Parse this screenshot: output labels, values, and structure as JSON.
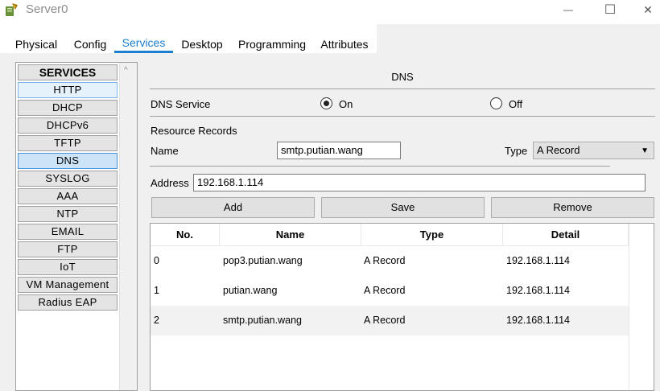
{
  "window": {
    "title": "Server0",
    "minimize_glyph": "—",
    "maximize_glyph": "☐",
    "close_glyph": "✕"
  },
  "tabs": [
    {
      "label": "Physical",
      "active": false
    },
    {
      "label": "Config",
      "active": false
    },
    {
      "label": "Services",
      "active": true
    },
    {
      "label": "Desktop",
      "active": false
    },
    {
      "label": "Programming",
      "active": false
    },
    {
      "label": "Attributes",
      "active": false
    }
  ],
  "services": {
    "header": "SERVICES",
    "items": [
      "HTTP",
      "DHCP",
      "DHCPv6",
      "TFTP",
      "DNS",
      "SYSLOG",
      "AAA",
      "NTP",
      "EMAIL",
      "FTP",
      "IoT",
      "VM Management",
      "Radius EAP"
    ],
    "selected": "DNS",
    "hovered": "HTTP"
  },
  "dns": {
    "title": "DNS",
    "service_label": "DNS Service",
    "on_label": "On",
    "off_label": "Off",
    "service_on": true,
    "resource_records_label": "Resource Records",
    "name_label": "Name",
    "name_value": "smtp.putian.wang",
    "type_label": "Type",
    "type_value": "A Record",
    "address_label": "Address",
    "address_value": "192.168.1.114",
    "buttons": {
      "add": "Add",
      "save": "Save",
      "remove": "Remove"
    }
  },
  "table": {
    "columns": [
      "No.",
      "Name",
      "Type",
      "Detail"
    ],
    "rows": [
      {
        "no": "0",
        "name": "pop3.putian.wang",
        "type": "A Record",
        "detail": "192.168.1.114"
      },
      {
        "no": "1",
        "name": "putian.wang",
        "type": "A Record",
        "detail": "192.168.1.114"
      },
      {
        "no": "2",
        "name": "smtp.putian.wang",
        "type": "A Record",
        "detail": "192.168.1.114"
      }
    ]
  },
  "colors": {
    "accent": "#1a7fd0",
    "selected_bg": "#cce4f7",
    "panel_bg": "#f0f0f0"
  }
}
